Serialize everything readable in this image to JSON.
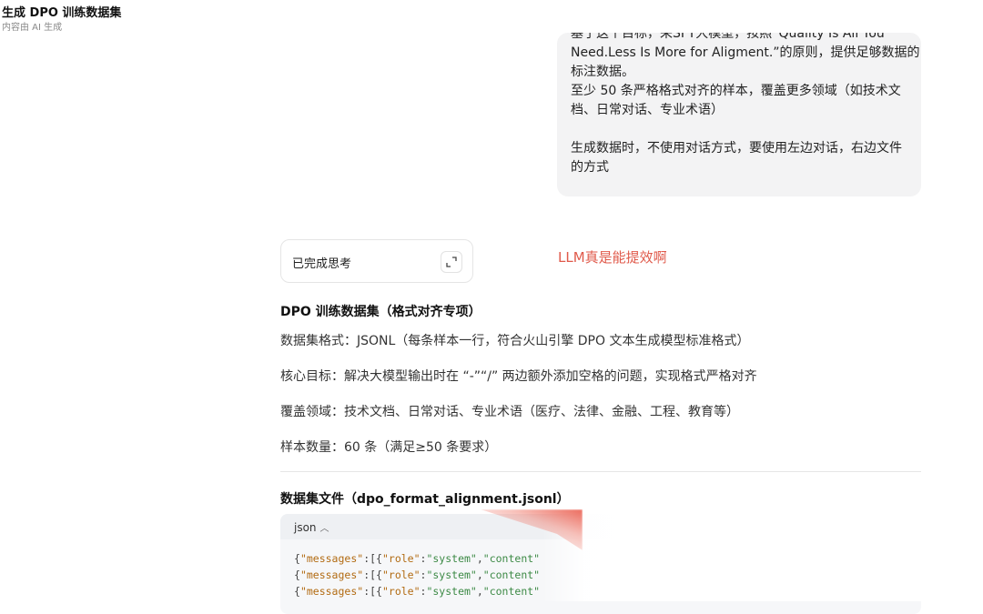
{
  "page": {
    "title": "生成 DPO 训练数据集",
    "subtitle": "内容由 AI 生成"
  },
  "user_message": {
    "lines": [
      "基于这个目标，采SFT大模型，按照“Quality Is All You",
      "Need.Less Is More for Aligment.”的原则，提供足够数据的",
      "标注数据。",
      "至少 50 条严格格式对齐的样本，覆盖更多领域（如技术文",
      "档、日常对话、专业术语）",
      "",
      "生成数据时，不使用对话方式，要使用左边对话，右边文件",
      "的方式"
    ]
  },
  "thinking": {
    "label": "已完成思考",
    "expand_icon": "expand-icon"
  },
  "annotation": "LLM真是能提效啊",
  "answer": {
    "title": "DPO 训练数据集（格式对齐专项）",
    "format_line": "数据集格式：JSONL（每条样本一行，符合火山引擎 DPO 文本生成模型标准格式）",
    "goal_line": "核心目标：解决大模型输出时在 “-”“/” 两边额外添加空格的问题，实现格式严格对齐",
    "domains_line": "覆盖领域：技术文档、日常对话、专业术语（医疗、法律、金融、工程、教育等）",
    "count_line": "样本数量：60 条（满足≥50 条要求）",
    "file_heading": "数据集文件（dpo_format_alignment.jsonl）"
  },
  "code": {
    "language": "json",
    "collapse_icon": "chevron-up-icon",
    "line_parts": [
      "{",
      "\"messages\"",
      ":[{",
      "\"role\"",
      ":",
      "\"system\"",
      ",",
      "\"content\""
    ],
    "line_count": 3
  },
  "colors": {
    "annotation": "#e05a4b",
    "bubble_bg": "#f3f3f4",
    "code_key": "#b26b12",
    "code_string": "#3d8a46"
  }
}
